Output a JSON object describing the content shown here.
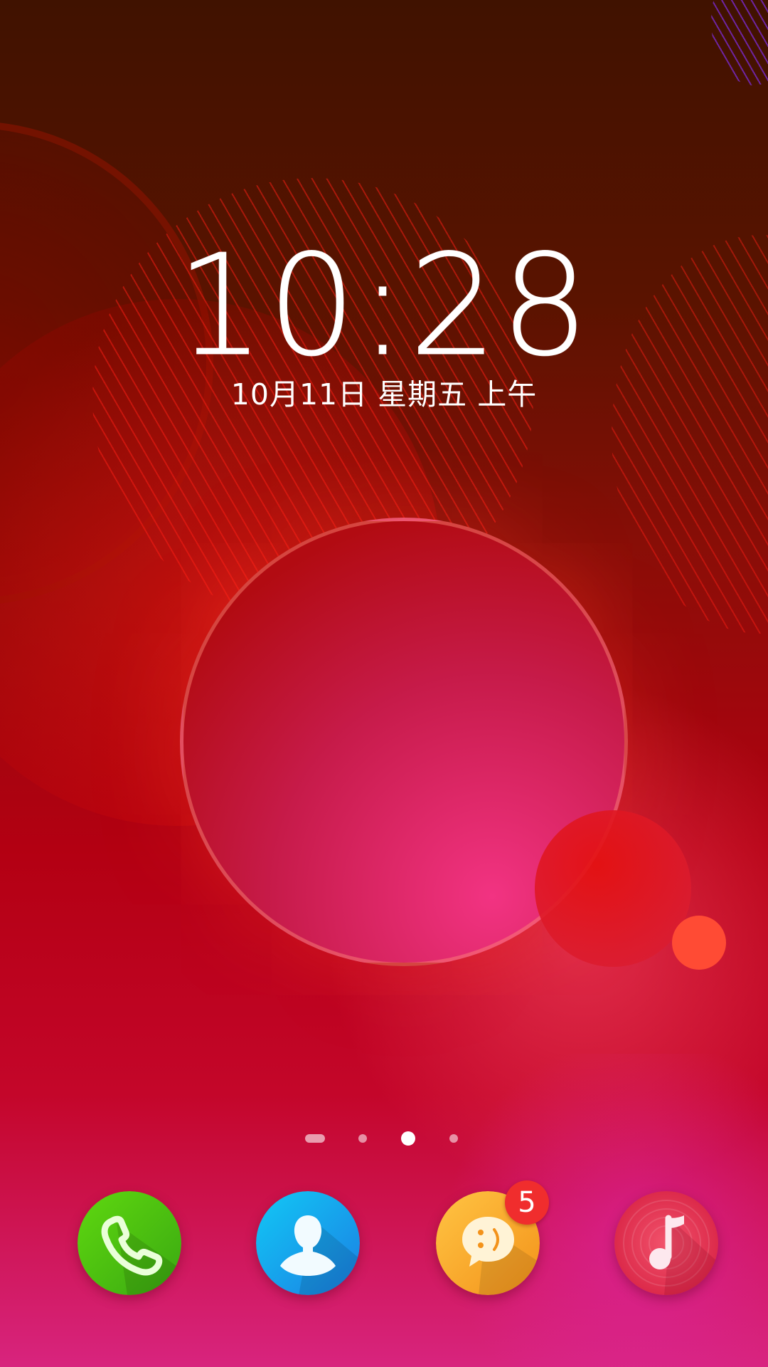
{
  "lockscreen": {
    "time": "10:28",
    "date": "10月11日  星期五  上午"
  },
  "pager": {
    "page_count": 4,
    "current_page": 3
  },
  "dock": {
    "apps": [
      {
        "id": "phone",
        "icon": "phone-icon",
        "color": "#4ccc12"
      },
      {
        "id": "contacts",
        "icon": "contacts-icon",
        "color": "#1aa6f0"
      },
      {
        "id": "messages",
        "icon": "messages-icon",
        "color": "#f7a21e",
        "badge": "5"
      },
      {
        "id": "music",
        "icon": "music-icon",
        "color": "#e8344e"
      }
    ]
  },
  "colors": {
    "badge": "#f02d2d",
    "text": "#ffffff"
  }
}
